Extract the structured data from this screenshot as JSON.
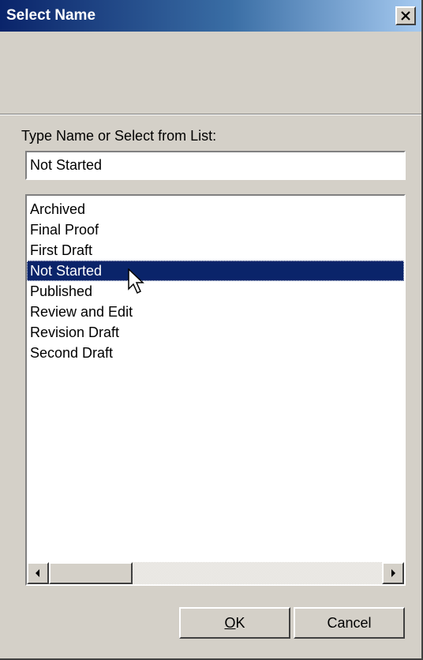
{
  "window": {
    "title": "Select Name",
    "close_symbol": "close-icon"
  },
  "prompt": {
    "label": "Type Name or Select from List:"
  },
  "name_input": {
    "value": "Not Started",
    "placeholder": ""
  },
  "list": {
    "items": [
      {
        "label": "Archived",
        "selected": false
      },
      {
        "label": "Final Proof",
        "selected": false
      },
      {
        "label": "First Draft",
        "selected": false
      },
      {
        "label": "Not Started",
        "selected": true
      },
      {
        "label": "Published",
        "selected": false
      },
      {
        "label": "Review and Edit",
        "selected": false
      },
      {
        "label": "Revision Draft",
        "selected": false
      },
      {
        "label": "Second Draft",
        "selected": false
      }
    ]
  },
  "buttons": {
    "ok_mnemonic": "O",
    "ok_rest": "K",
    "cancel_label": "Cancel"
  },
  "colors": {
    "titlebar_start": "#0a246a",
    "titlebar_end": "#a6caf0",
    "selection": "#0a246a",
    "face": "#d4d0c8"
  }
}
